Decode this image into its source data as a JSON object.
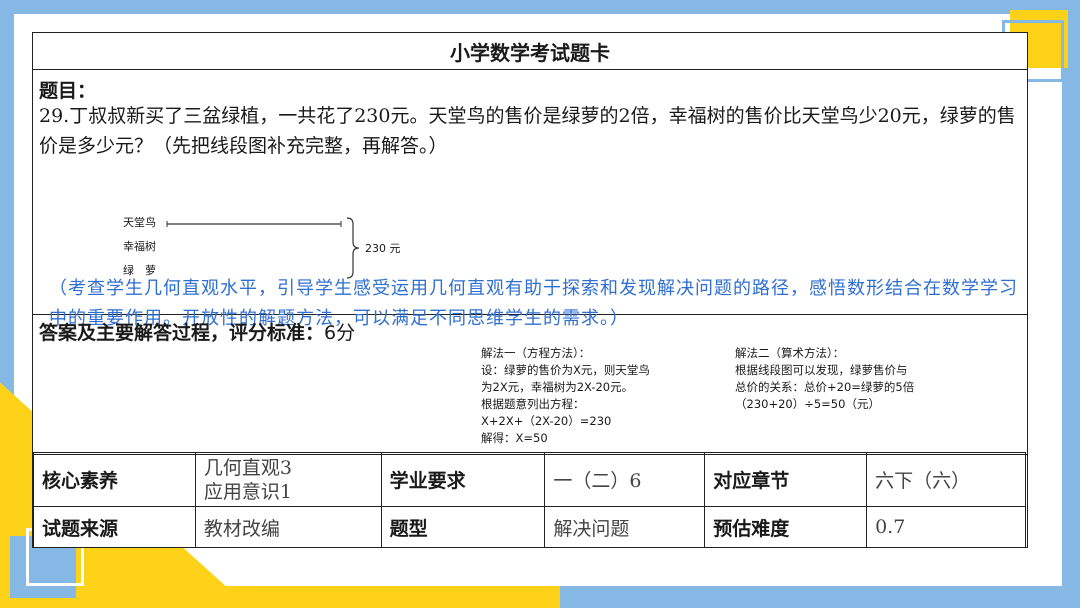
{
  "card_title": "小学数学考试题卡",
  "question": {
    "label": "题目：",
    "text": "29.丁叔叔新买了三盆绿植，一共花了230元。天堂鸟的售价是绿萝的2倍，幸福树的售价比天堂鸟少20元，绿萝的售价是多少元？（先把线段图补充完整，再解答。）",
    "diagram": {
      "labels": [
        "天堂鸟",
        "幸福树",
        "绿　萝"
      ],
      "total": "230 元"
    },
    "note": "（考查学生几何直观水平，引导学生感受运用几何直观有助于探索和发现解决问题的路径，感悟数形结合在数学学习中的重要作用。开放性的解题方法，可以满足不同思维学生的需求。）"
  },
  "answer": {
    "label": "答案及主要解答过程，评分标准：",
    "score": "6分",
    "method1": [
      "解法一（方程方法）：",
      "设：绿萝的售价为X元，则天堂鸟",
      "为2X元，幸福树为2X-20元。",
      "根据题意列出方程：",
      "X+2X+（2X-20）=230",
      "解得：X=50"
    ],
    "method2": [
      "解法二（算术方法）：",
      "根据线段图可以发现，绿萝售价与",
      "总价的关系：总价+20=绿萝的5倍",
      "（230+20）÷5=50（元）"
    ]
  },
  "info": {
    "row1": {
      "core_label": "核心素养",
      "core_value": [
        "几何直观3",
        "应用意识1"
      ],
      "req_label": "学业要求",
      "req_value": "一（二）6",
      "chapter_label": "对应章节",
      "chapter_value": "六下（六）"
    },
    "row2": {
      "source_label": "试题来源",
      "source_value": "教材改编",
      "type_label": "题型",
      "type_value": "解决问题",
      "difficulty_label": "预估难度",
      "difficulty_value": "0.7"
    }
  },
  "colors": {
    "frame_blue": "#86b8e6",
    "frame_yellow": "#ffd21a",
    "note_blue": "#2f6fd1"
  }
}
